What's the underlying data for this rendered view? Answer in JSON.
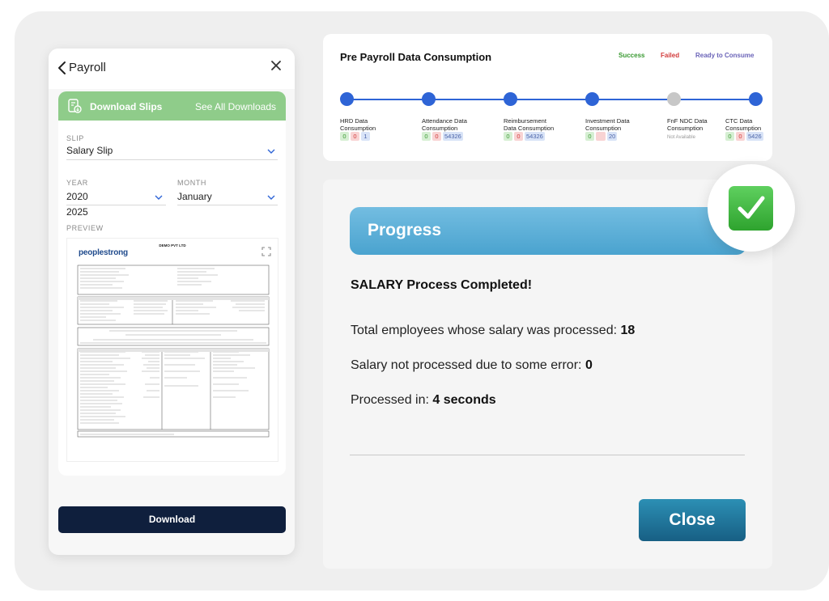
{
  "phone": {
    "title": "Payroll",
    "download_slips": {
      "title": "Download Slips",
      "see_all": "See All Downloads"
    },
    "slip": {
      "label": "SLIP",
      "value": "Salary Slip"
    },
    "year": {
      "label": "YEAR",
      "value": "2020",
      "extra_option": "2025"
    },
    "month": {
      "label": "MONTH",
      "value": "January"
    },
    "preview_label": "PREVIEW",
    "preview": {
      "logo_main": "peoplestrong",
      "company": "DEMO PVT LTD",
      "doc_caption": "Pay Slip for the month of May 2020"
    },
    "download_label": "Download"
  },
  "pre_payroll": {
    "title": "Pre Payroll Data Consumption",
    "legend": [
      {
        "label": "Success",
        "color": "#3a9a32"
      },
      {
        "label": "Failed",
        "color": "#d23b3b"
      },
      {
        "label": "Ready to Consume",
        "color": "#6a63b8"
      }
    ],
    "steps": [
      {
        "line1": "HRD Data",
        "line2": "Consumption",
        "badges": [
          "0",
          "0",
          "1"
        ],
        "status": "done"
      },
      {
        "line1": "Attendance Data",
        "line2": "Consumption",
        "badges": [
          "0",
          "0",
          "54326"
        ],
        "status": "done"
      },
      {
        "line1": "Reimbursement",
        "line2": "Data Consumption",
        "badges": [
          "0",
          "0",
          "54326"
        ],
        "status": "done"
      },
      {
        "line1": "Investment Data",
        "line2": "Consumption",
        "badges": [
          "0",
          "",
          "20"
        ],
        "status": "done"
      },
      {
        "line1": "FnF NDC Data",
        "line2": "Consumption",
        "note": "Not Available",
        "status": "pending"
      },
      {
        "line1": "CTC Data",
        "line2": "Consumption",
        "badges": [
          "0",
          "0",
          "5426"
        ],
        "status": "done"
      }
    ]
  },
  "progress": {
    "title": "Progress",
    "completed": "SALARY Process Completed!",
    "total_label": "Total employees whose salary was processed:",
    "total_value": "18",
    "error_label": "Salary not processed due to some error:",
    "error_value": "0",
    "time_label": "Processed in:",
    "time_value": "4 seconds",
    "close_label": "Close"
  }
}
